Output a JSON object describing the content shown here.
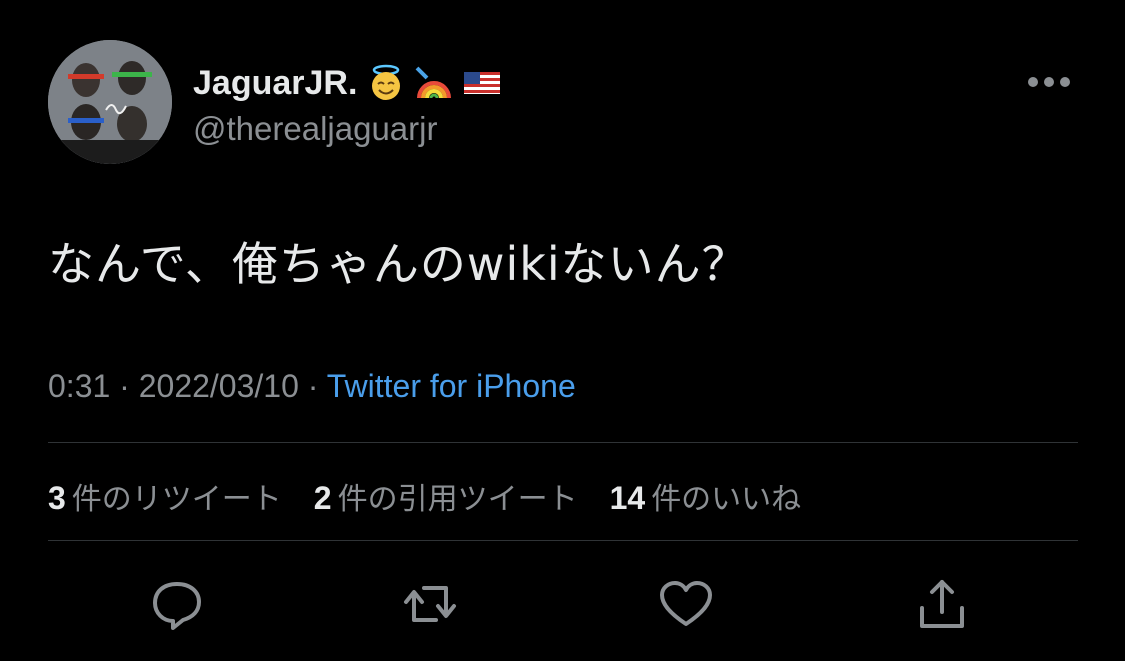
{
  "user": {
    "display_name": "JaguarJR.",
    "handle": "@therealjaguarjr",
    "badges": [
      "smiling-face-with-halo-emoji",
      "rainbow-emoji",
      "us-flag-emoji"
    ]
  },
  "tweet": {
    "text": "なんで、俺ちゃんのwikiないん？",
    "time": "0:31",
    "separator": "·",
    "date": "2022/03/10",
    "source": "Twitter for iPhone"
  },
  "stats": {
    "retweets_count": "3",
    "retweets_label": "件のリツイート",
    "quotes_count": "2",
    "quotes_label": "件の引用ツイート",
    "likes_count": "14",
    "likes_label": "件のいいね"
  },
  "actions": [
    "reply-icon",
    "retweet-icon",
    "like-icon",
    "share-icon"
  ],
  "colors": {
    "background": "#000000",
    "primary_text": "#e7e9ea",
    "secondary_text": "#8b8f93",
    "link": "#4a9eeb",
    "divider": "#2f3336"
  }
}
